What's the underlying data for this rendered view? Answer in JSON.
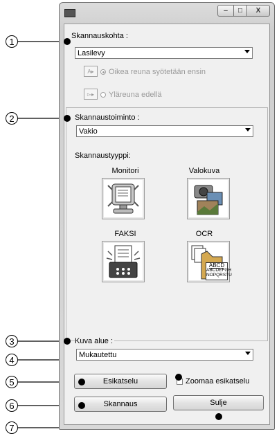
{
  "scan_location": {
    "label": "Skannauskohta :",
    "value": "Lasilevy",
    "option_right_edge": "Oikea reuna syötetään ensin",
    "option_top_edge": "Yläreuna edellä"
  },
  "scan_function": {
    "label": "Skannaustoiminto :",
    "value": "Vakio"
  },
  "scan_type": {
    "label": "Skannaustyyppi:",
    "items": [
      {
        "label": "Monitori"
      },
      {
        "label": "Valokuva"
      },
      {
        "label": "FAKSI"
      },
      {
        "label": "OCR"
      }
    ],
    "ocr_sample_lines": [
      "ABCD",
      "ABCDEFGH",
      "NOPQRSTU"
    ]
  },
  "image_area": {
    "label": "Kuva alue :",
    "value": "Mukautettu"
  },
  "buttons": {
    "preview": "Esikatselu",
    "zoom_preview": "Zoomaa esikatselu",
    "scan": "Skannaus",
    "close": "Sulje"
  },
  "window": {
    "minimize_symbol": "–",
    "maximize_symbol": "□",
    "close_symbol": "X"
  },
  "callouts": [
    "1",
    "2",
    "3",
    "4",
    "5",
    "6",
    "7"
  ]
}
